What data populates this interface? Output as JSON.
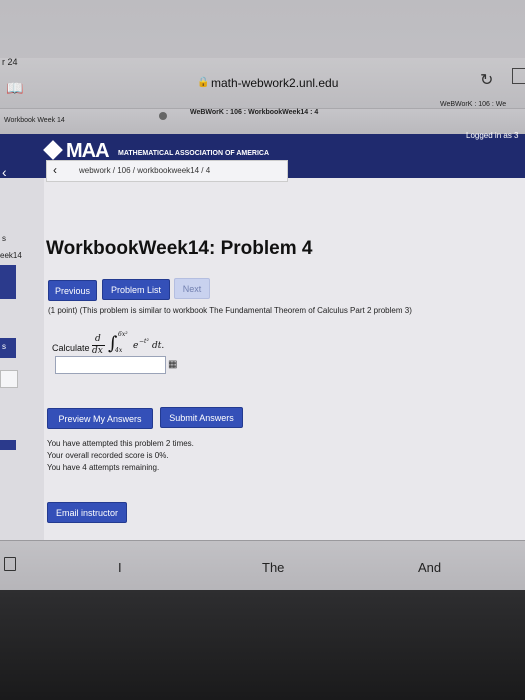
{
  "status": {
    "time": "r 24"
  },
  "browser": {
    "url": "math-webwork2.unl.edu",
    "tabs": [
      {
        "label": "Workbook Week 14"
      },
      {
        "label": "WeBWorK : 106 : WorkbookWeek14 : 4"
      },
      {
        "label": "WeBWorK : 106 : We"
      }
    ]
  },
  "banner": {
    "logo_text": "MAA",
    "org_name": "MATHEMATICAL ASSOCIATION OF AMERICA",
    "logged_in": "Logged in as 3"
  },
  "sidebar": {
    "partial_label": "eek14",
    "partial_s1": "s",
    "partial_s2": "s"
  },
  "breadcrumb": {
    "text": "webwork / 106 / workbookweek14 / 4"
  },
  "page": {
    "title": "WorkbookWeek14: Problem 4"
  },
  "nav": {
    "previous": "Previous",
    "problem_list": "Problem List",
    "next": "Next"
  },
  "problem": {
    "statement": "(1 point) (This problem is similar to workbook The Fundamental Theorem of Calculus Part 2 problem 3)",
    "calculate": "Calculate",
    "d": "d",
    "dx": "dx",
    "upper": "6x²",
    "lower": "4x",
    "integrand": "e",
    "exp": "−t²",
    "dt": "dt."
  },
  "answer": {
    "value": "",
    "placeholder": ""
  },
  "actions": {
    "preview": "Preview My Answers",
    "submit": "Submit Answers"
  },
  "attempts": [
    "You have attempted this problem 2 times.",
    "Your overall recorded score is 0%.",
    "You have 4 attempts remaining."
  ],
  "email": {
    "label": "Email instructor"
  },
  "keyboard": {
    "suggestions": [
      "I",
      "The",
      "And"
    ]
  }
}
